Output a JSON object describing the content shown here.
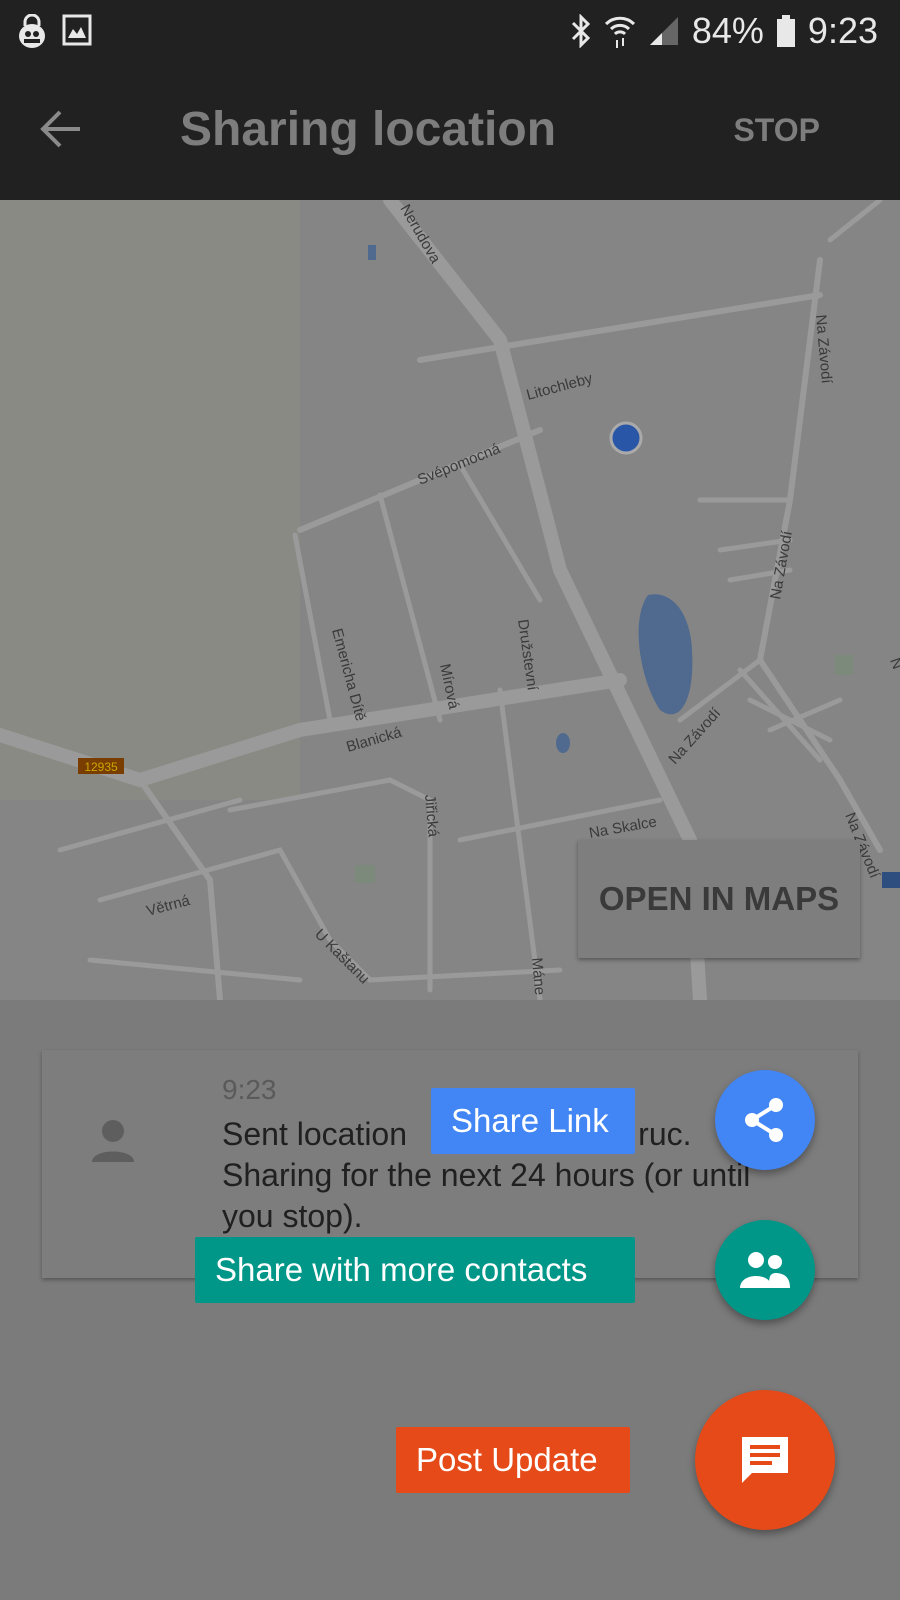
{
  "status_bar": {
    "battery": "84%",
    "time": "9:23",
    "icons": [
      "vpn-lock-icon",
      "image-icon",
      "bluetooth-icon",
      "wifi-icon",
      "signal-icon",
      "battery-icon"
    ]
  },
  "app_bar": {
    "title": "Sharing location",
    "stop_label": "STOP",
    "back_icon": "arrow-back-icon"
  },
  "map": {
    "streets": [
      "Nerudova",
      "Litochleby",
      "Svépomocná",
      "Na Závodí",
      "Na Závodí",
      "Emericha Dítě",
      "Mírová",
      "Družstevní",
      "Blanická",
      "Na Závodí",
      "Jiřická",
      "Na Skalce",
      "Větrná",
      "U Kaštanu",
      "Máne",
      "Na Závodí",
      "N"
    ],
    "road_badge": "12935",
    "open_in_maps": "OPEN IN MAPS",
    "colors": {
      "location_dot": "#2a56a8",
      "water": "#4f6a8e",
      "road_badge": "#7a3d00"
    }
  },
  "card": {
    "time": "9:23",
    "message": "Sent location to ...ruc. Sharing for the next 24 hours (or until you stop).",
    "message_visible": "Sent location                          ruc. Sharing for the next 24 hours (or until you stop)."
  },
  "fab_menu": {
    "share_link": {
      "label": "Share Link",
      "color": "#4285f4",
      "icon": "share-icon"
    },
    "share_contacts": {
      "label": "Share with more contacts",
      "color": "#009688",
      "icon": "people-icon"
    },
    "post_update": {
      "label": "Post Update",
      "color": "#e64a19",
      "icon": "chat-icon"
    }
  }
}
